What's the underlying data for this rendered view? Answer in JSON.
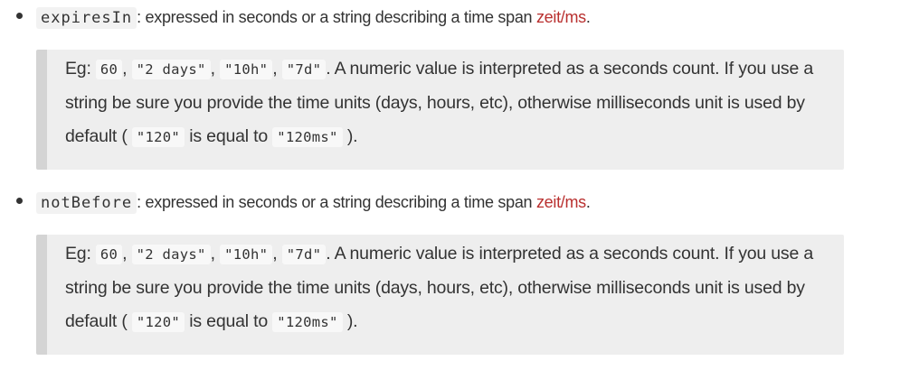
{
  "items": [
    {
      "name": "expiresIn",
      "description": ": expressed in seconds or a string describing a time span ",
      "link": "zeit/ms",
      "period": ".",
      "quote": {
        "prefix": "Eg: ",
        "v1": "60",
        "sep1": ", ",
        "v2": "\"2 days\"",
        "sep2": ", ",
        "v3": "\"10h\"",
        "sep3": ", ",
        "v4": "\"7d\"",
        "text1": ". A numeric value is interpreted as a seconds count. If you use a string be sure you provide the time units (days, hours, etc), otherwise milliseconds unit is used by default (",
        "c1": "\"120\"",
        "text2": " is equal to ",
        "c2": "\"120ms\"",
        "text3": ")."
      }
    },
    {
      "name": "notBefore",
      "description": ": expressed in seconds or a string describing a time span ",
      "link": "zeit/ms",
      "period": ".",
      "quote": {
        "prefix": "Eg: ",
        "v1": "60",
        "sep1": ", ",
        "v2": "\"2 days\"",
        "sep2": ", ",
        "v3": "\"10h\"",
        "sep3": ", ",
        "v4": "\"7d\"",
        "text1": ". A numeric value is interpreted as a seconds count. If you use a string be sure you provide the time units (days, hours, etc), otherwise milliseconds unit is used by default (",
        "c1": "\"120\"",
        "text2": " is equal to ",
        "c2": "\"120ms\"",
        "text3": ")."
      }
    }
  ]
}
